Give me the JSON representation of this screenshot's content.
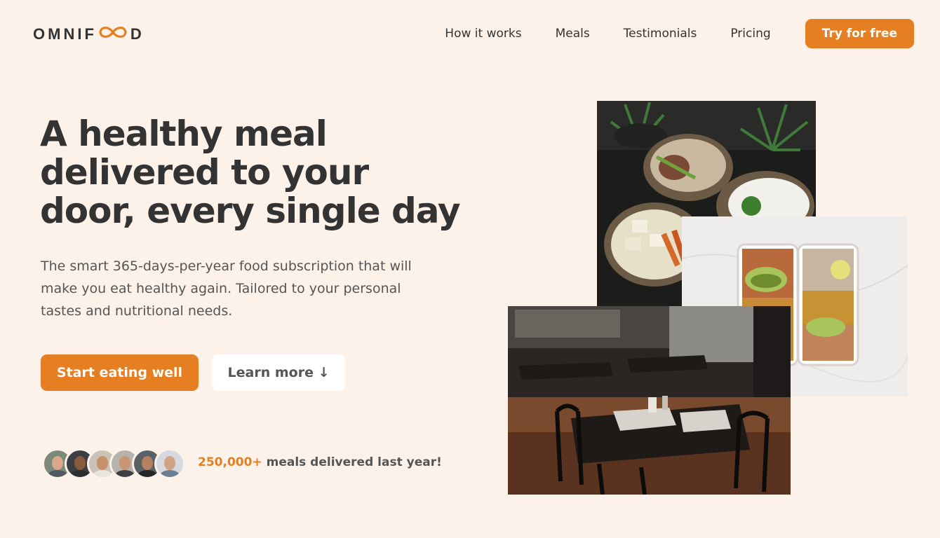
{
  "brand": {
    "logo_left": "OMNIF",
    "logo_right": "D",
    "accent_color": "#e67e22",
    "background_color": "#fdf2e9"
  },
  "nav": {
    "items": [
      {
        "label": "How it works"
      },
      {
        "label": "Meals"
      },
      {
        "label": "Testimonials"
      },
      {
        "label": "Pricing"
      }
    ],
    "cta_label": "Try for free"
  },
  "hero": {
    "title": "A healthy meal delivered to your door, every single day",
    "description": "The smart 365-days-per-year food subscription that will make you eat healthy again. Tailored to your personal tastes and nutritional needs.",
    "primary_button": "Start eating well",
    "secondary_button": "Learn more ↓"
  },
  "delivered": {
    "count": "250,000+",
    "text": " meals delivered last year!"
  },
  "avatars": [
    {
      "name": "customer-avatar-1"
    },
    {
      "name": "customer-avatar-2"
    },
    {
      "name": "customer-avatar-3"
    },
    {
      "name": "customer-avatar-4"
    },
    {
      "name": "customer-avatar-5"
    },
    {
      "name": "customer-avatar-6"
    }
  ]
}
